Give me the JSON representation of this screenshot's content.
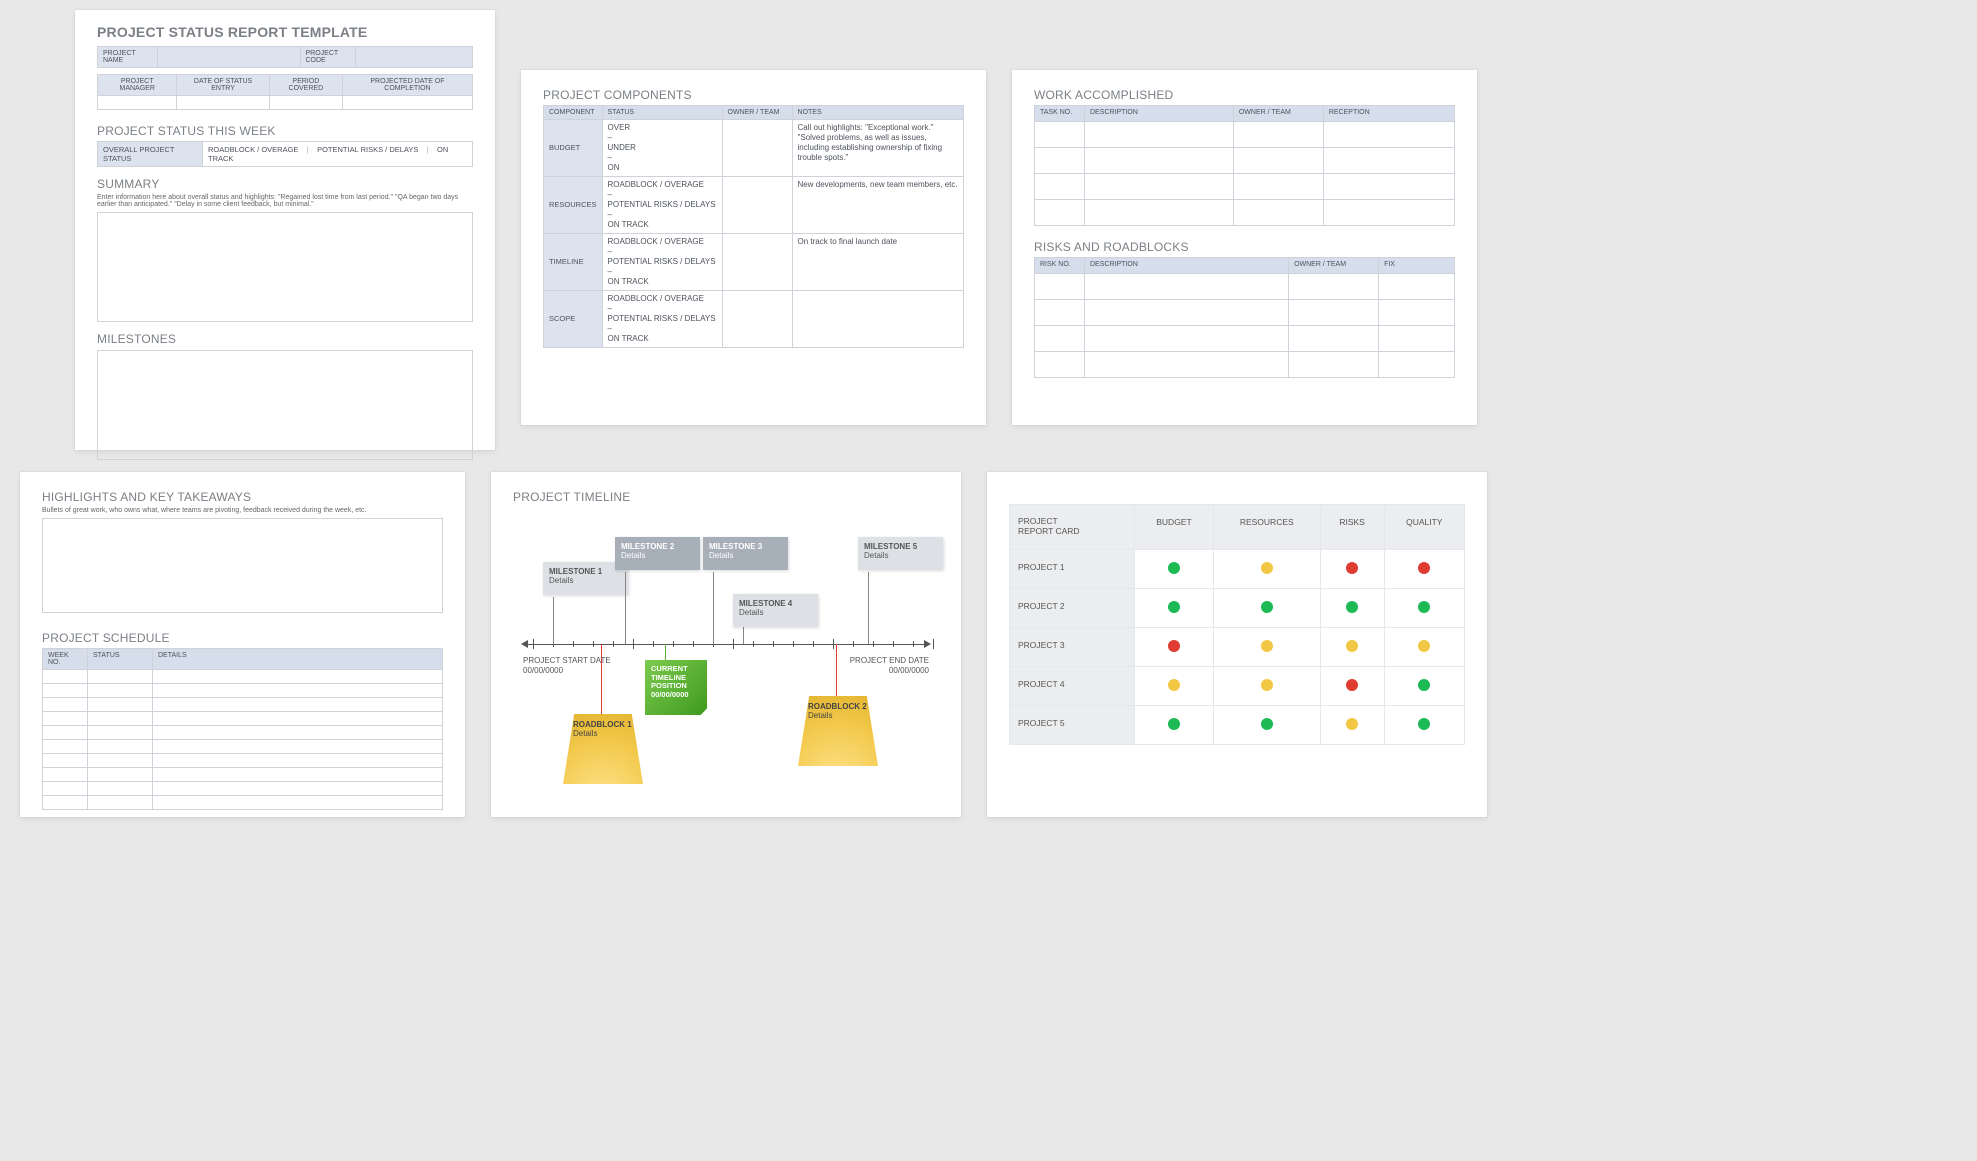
{
  "card11": {
    "title": "PROJECT STATUS REPORT TEMPLATE",
    "meta": {
      "nameLbl": "PROJECT NAME",
      "codeLbl": "PROJECT CODE",
      "managerLbl": "PROJECT MANAGER",
      "dateEntryLbl": "DATE OF STATUS ENTRY",
      "periodLbl": "PERIOD COVERED",
      "completionLbl": "PROJECTED DATE OF COMPLETION"
    },
    "weekHdr": "PROJECT STATUS THIS WEEK",
    "statusRow": {
      "label": "OVERALL PROJECT STATUS",
      "opt1": "ROADBLOCK / OVERAGE",
      "opt2": "POTENTIAL RISKS / DELAYS",
      "opt3": "ON TRACK",
      "sep": "|"
    },
    "summaryHdr": "SUMMARY",
    "summaryHint": "Enter information here about overall status and highlights: \"Regained lost time from last period.\" \"QA began two days earlier than anticipated.\" \"Delay in some client feedback, but minimal.\"",
    "milestonesHdr": "MILESTONES"
  },
  "card12": {
    "title": "PROJECT COMPONENTS",
    "headers": {
      "c1": "COMPONENT",
      "c2": "STATUS",
      "c3": "OWNER / TEAM",
      "c4": "NOTES"
    },
    "rows": [
      {
        "label": "BUDGET",
        "status": "OVER\n–\nUNDER\n–\nON",
        "notes": "Call out highlights:  \"Exceptional work.\"  \"Solved problems, as well as issues, including establishing ownership of fixing trouble spots.\""
      },
      {
        "label": "RESOURCES",
        "status": "ROADBLOCK / OVERAGE\n–\nPOTENTIAL RISKS / DELAYS\n–\nON TRACK",
        "notes": "New developments, new team members, etc."
      },
      {
        "label": "TIMELINE",
        "status": "ROADBLOCK / OVERAGE\n–\nPOTENTIAL RISKS / DELAYS\n–\nON TRACK",
        "notes": "On track to final launch date"
      },
      {
        "label": "SCOPE",
        "status": "ROADBLOCK / OVERAGE\n–\nPOTENTIAL RISKS / DELAYS\n–\nON TRACK",
        "notes": ""
      }
    ]
  },
  "card13": {
    "t1": {
      "title": "WORK ACCOMPLISHED",
      "headers": {
        "h1": "TASK NO.",
        "h2": "DESCRIPTION",
        "h3": "OWNER / TEAM",
        "h4": "RECEPTION"
      }
    },
    "t2": {
      "title": "RISKS AND ROADBLOCKS",
      "headers": {
        "h1": "RISK NO.",
        "h2": "DESCRIPTION",
        "h3": "OWNER / TEAM",
        "h4": "FIX"
      }
    }
  },
  "card21": {
    "hlHdr": "HIGHLIGHTS AND KEY TAKEAWAYS",
    "hlHint": "Bullets of great work, who owns what, where teams are pivoting, feedback received during the week, etc.",
    "schedHdr": "PROJECT SCHEDULE",
    "sched": {
      "h1": "WEEK NO.",
      "h2": "STATUS",
      "h3": "DETAILS"
    }
  },
  "card22": {
    "title": "PROJECT TIMELINE",
    "startLbl": "PROJECT START DATE",
    "startDate": "00/00/0000",
    "endLbl": "PROJECT END DATE",
    "endDate": "00/00/0000",
    "m1": {
      "name": "MILESTONE 1",
      "sub": "Details"
    },
    "m2": {
      "name": "MILESTONE 2",
      "sub": "Details"
    },
    "m3": {
      "name": "MILESTONE 3",
      "sub": "Details"
    },
    "m4": {
      "name": "MILESTONE 4",
      "sub": "Details"
    },
    "m5": {
      "name": "MILESTONE 5",
      "sub": "Details"
    },
    "r1": {
      "name": "ROADBLOCK 1",
      "sub": "Details"
    },
    "r2": {
      "name": "ROADBLOCK 2",
      "sub": "Details"
    },
    "cur1": "CURRENT",
    "cur2": "TIMELINE",
    "cur3": "POSITION",
    "cur4": "00/00/0000"
  },
  "card23": {
    "hdr": {
      "h0a": "PROJECT",
      "h0b": "REPORT CARD",
      "h1": "BUDGET",
      "h2": "RESOURCES",
      "h3": "RISKS",
      "h4": "QUALITY"
    },
    "rows": [
      {
        "name": "PROJECT 1",
        "cells": [
          "g",
          "y",
          "r",
          "r"
        ]
      },
      {
        "name": "PROJECT 2",
        "cells": [
          "g",
          "g",
          "g",
          "g"
        ]
      },
      {
        "name": "PROJECT 3",
        "cells": [
          "r",
          "y",
          "y",
          "y"
        ]
      },
      {
        "name": "PROJECT 4",
        "cells": [
          "y",
          "y",
          "r",
          "g"
        ]
      },
      {
        "name": "PROJECT 5",
        "cells": [
          "g",
          "g",
          "y",
          "g"
        ]
      }
    ]
  }
}
